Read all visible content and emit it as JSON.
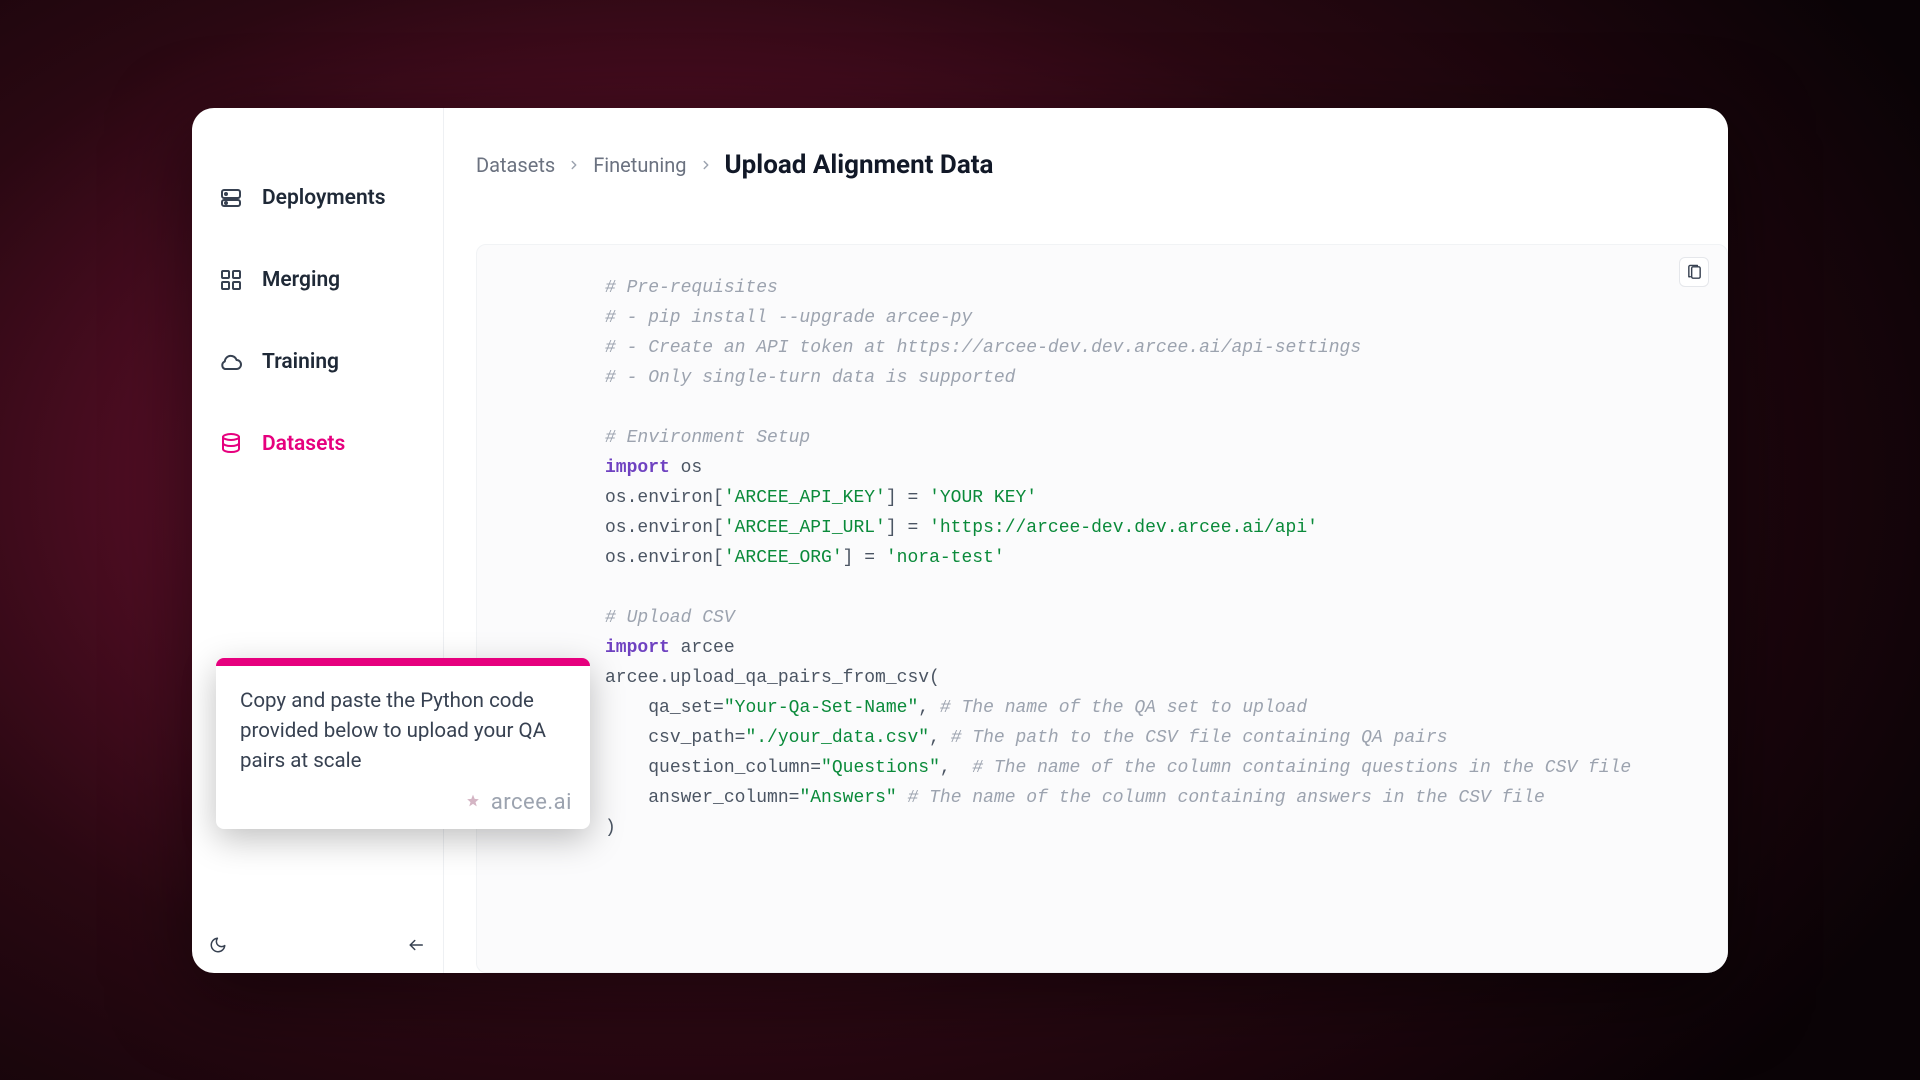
{
  "sidebar": {
    "items": [
      {
        "label": "Deployments",
        "icon": "server-icon",
        "active": false
      },
      {
        "label": "Merging",
        "icon": "merge-icon",
        "active": false
      },
      {
        "label": "Training",
        "icon": "cloud-icon",
        "active": false
      },
      {
        "label": "Datasets",
        "icon": "database-icon",
        "active": true
      }
    ]
  },
  "breadcrumb": {
    "items": [
      "Datasets",
      "Finetuning"
    ],
    "current": "Upload Alignment Data"
  },
  "callout": {
    "text": "Copy and paste the Python code provided below to upload your QA pairs at scale",
    "brand": "arcee.ai"
  },
  "code_lines": [
    [
      {
        "cls": "tok-comment",
        "text": "# Pre-requisites"
      }
    ],
    [
      {
        "cls": "tok-comment",
        "text": "# - pip install --upgrade arcee-py"
      }
    ],
    [
      {
        "cls": "tok-comment",
        "text": "# - Create an API token at https://arcee-dev.dev.arcee.ai/api-settings"
      }
    ],
    [
      {
        "cls": "tok-comment",
        "text": "# - Only single-turn data is supported"
      }
    ],
    [],
    [
      {
        "cls": "tok-comment",
        "text": "# Environment Setup"
      }
    ],
    [
      {
        "cls": "tok-kw",
        "text": "import"
      },
      {
        "cls": "tok-default",
        "text": " os"
      }
    ],
    [
      {
        "cls": "tok-default",
        "text": "os.environ["
      },
      {
        "cls": "tok-str",
        "text": "'ARCEE_API_KEY'"
      },
      {
        "cls": "tok-default",
        "text": "] = "
      },
      {
        "cls": "tok-str",
        "text": "'YOUR KEY'"
      }
    ],
    [
      {
        "cls": "tok-default",
        "text": "os.environ["
      },
      {
        "cls": "tok-str",
        "text": "'ARCEE_API_URL'"
      },
      {
        "cls": "tok-default",
        "text": "] = "
      },
      {
        "cls": "tok-str",
        "text": "'https://arcee-dev.dev.arcee.ai/api'"
      }
    ],
    [
      {
        "cls": "tok-default",
        "text": "os.environ["
      },
      {
        "cls": "tok-str",
        "text": "'ARCEE_ORG'"
      },
      {
        "cls": "tok-default",
        "text": "] = "
      },
      {
        "cls": "tok-str",
        "text": "'nora-test'"
      }
    ],
    [],
    [
      {
        "cls": "tok-comment",
        "text": "# Upload CSV"
      }
    ],
    [
      {
        "cls": "tok-kw",
        "text": "import"
      },
      {
        "cls": "tok-default",
        "text": " arcee"
      }
    ],
    [
      {
        "cls": "tok-default",
        "text": "arcee.upload_qa_pairs_from_csv("
      }
    ],
    [
      {
        "cls": "tok-default",
        "text": "    qa_set="
      },
      {
        "cls": "tok-str",
        "text": "\"Your-Qa-Set-Name\""
      },
      {
        "cls": "tok-default",
        "text": ", "
      },
      {
        "cls": "tok-comment",
        "text": "# The name of the QA set to upload"
      }
    ],
    [
      {
        "cls": "tok-default",
        "text": "    csv_path="
      },
      {
        "cls": "tok-str",
        "text": "\"./your_data.csv\""
      },
      {
        "cls": "tok-default",
        "text": ", "
      },
      {
        "cls": "tok-comment",
        "text": "# The path to the CSV file containing QA pairs"
      }
    ],
    [
      {
        "cls": "tok-default",
        "text": "    question_column="
      },
      {
        "cls": "tok-str",
        "text": "\"Questions\""
      },
      {
        "cls": "tok-default",
        "text": ",  "
      },
      {
        "cls": "tok-comment",
        "text": "# The name of the column containing questions in the CSV file"
      }
    ],
    [
      {
        "cls": "tok-default",
        "text": "    answer_column="
      },
      {
        "cls": "tok-str",
        "text": "\"Answers\""
      },
      {
        "cls": "tok-default",
        "text": " "
      },
      {
        "cls": "tok-comment",
        "text": "# The name of the column containing answers in the CSV file"
      }
    ],
    [
      {
        "cls": "tok-default",
        "text": ")"
      }
    ]
  ]
}
